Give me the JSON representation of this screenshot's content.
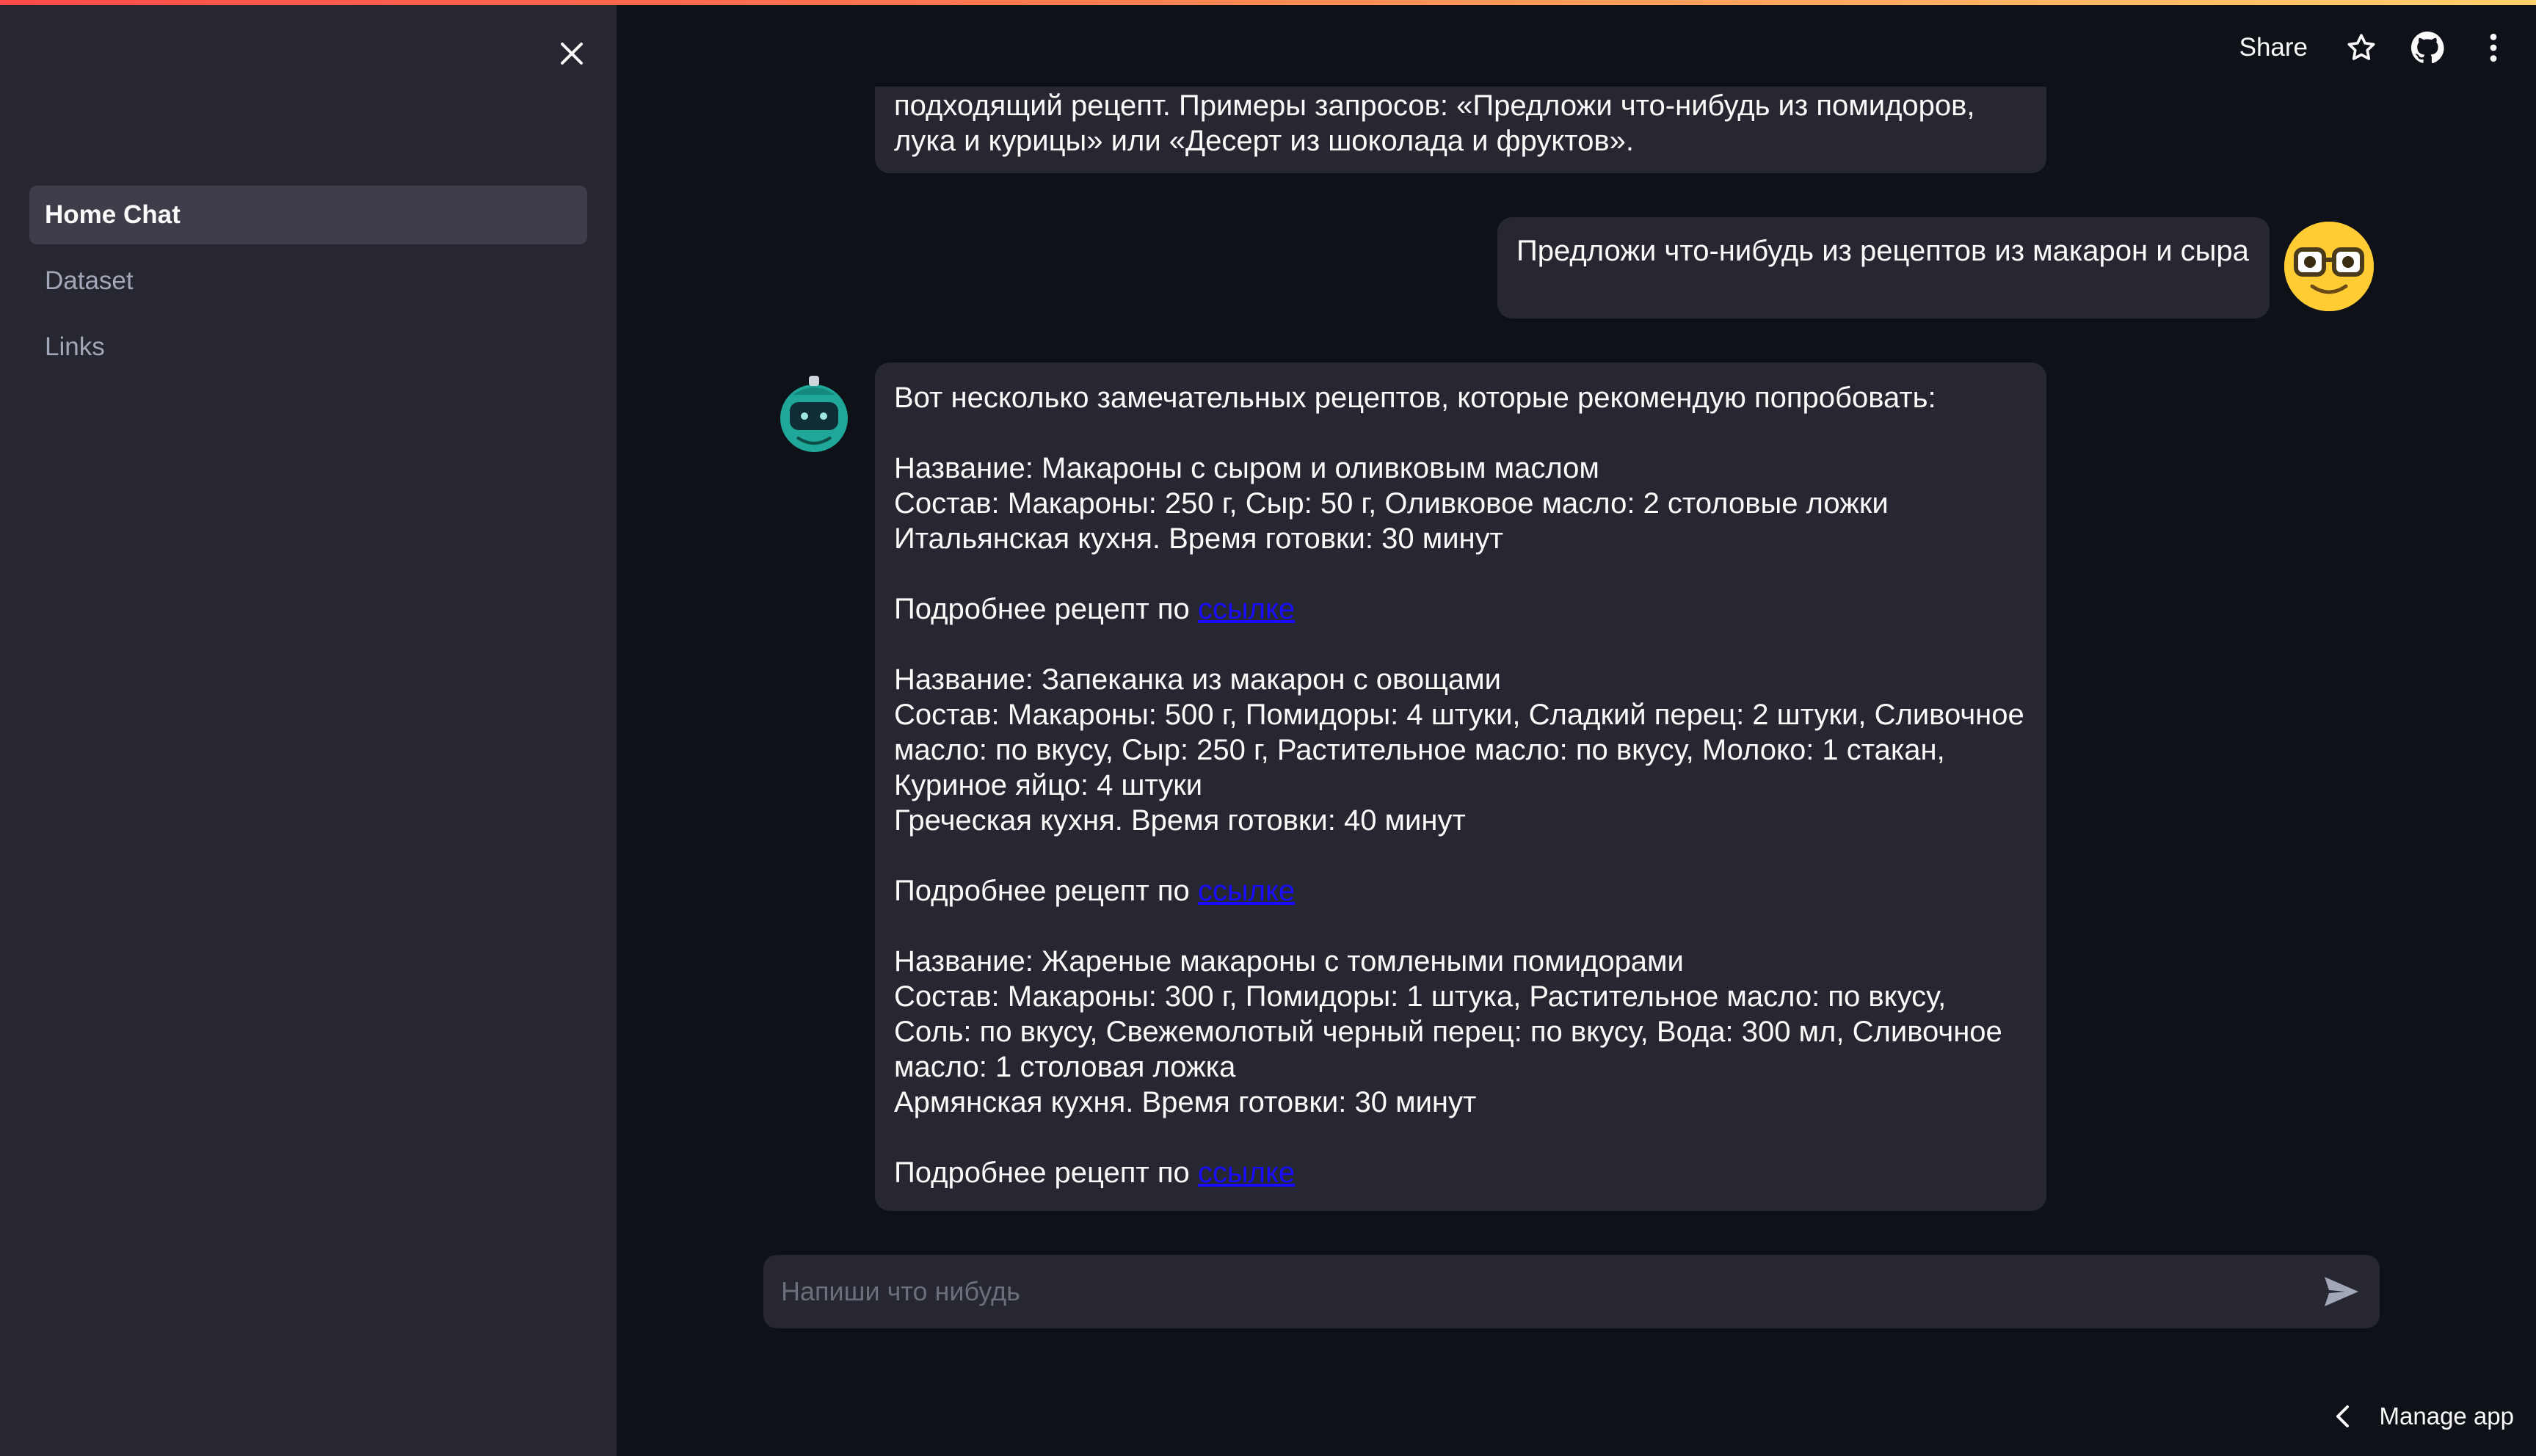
{
  "header": {
    "share_label": "Share",
    "icons": [
      "star-icon",
      "github-icon",
      "more-vertical-icon"
    ]
  },
  "sidebar": {
    "items": [
      {
        "label": "Home Chat",
        "active": true
      },
      {
        "label": "Dataset",
        "active": false
      },
      {
        "label": "Links",
        "active": false
      }
    ]
  },
  "chat": {
    "assistant_intro": {
      "lines": [
        "подходящий рецепт. Примеры запросов: «Предложи что-нибудь из помидоров,",
        "лука и курицы» или «Десерт из шоколада и фруктов»."
      ]
    },
    "user_message": "Предложи что-нибудь из рецептов из макарон и сыра",
    "assistant_reply": {
      "intro": "Вот несколько замечательных рецептов, которые рекомендую попробовать:",
      "more_prefix": "Подробнее рецепт по",
      "link_text": "ссылке",
      "recipes": [
        {
          "lines": [
            "Название: Макароны с сыром и оливковым маслом",
            "Состав: Макароны: 250 г, Сыр: 50 г, Оливковое масло: 2 столовые ложки",
            "Итальянская кухня. Время готовки: 30 минут"
          ]
        },
        {
          "lines": [
            "Название: Запеканка из макарон с овощами",
            "Состав: Макароны: 500 г, Помидоры: 4 штуки, Сладкий перец: 2 штуки, Сливочное",
            "масло: по вкусу, Сыр: 250 г, Растительное масло: по вкусу, Молоко: 1 стакан,",
            "Куриное яйцо: 4 штуки",
            "Греческая кухня. Время готовки: 40 минут"
          ]
        },
        {
          "lines": [
            "Название: Жареные макароны с томлеными помидорами",
            "Состав: Макароны: 300 г, Помидоры: 1 штука, Растительное масло: по вкусу,",
            "Соль: по вкусу, Свежемолотый черный перец: по вкусу, Вода: 300 мл, Сливочное",
            "масло: 1 столовая ложка",
            "Армянская кухня. Время готовки: 30 минут"
          ]
        }
      ]
    }
  },
  "input": {
    "placeholder": "Напиши что нибудь"
  },
  "footer": {
    "manage_app_label": "Manage app"
  },
  "colors": {
    "background": "#0e1117",
    "sidebar": "#262730",
    "bubble": "#262730",
    "link": "#1a0dff",
    "user_avatar": "#ffcc33",
    "bot_avatar": "#1fa89a"
  }
}
